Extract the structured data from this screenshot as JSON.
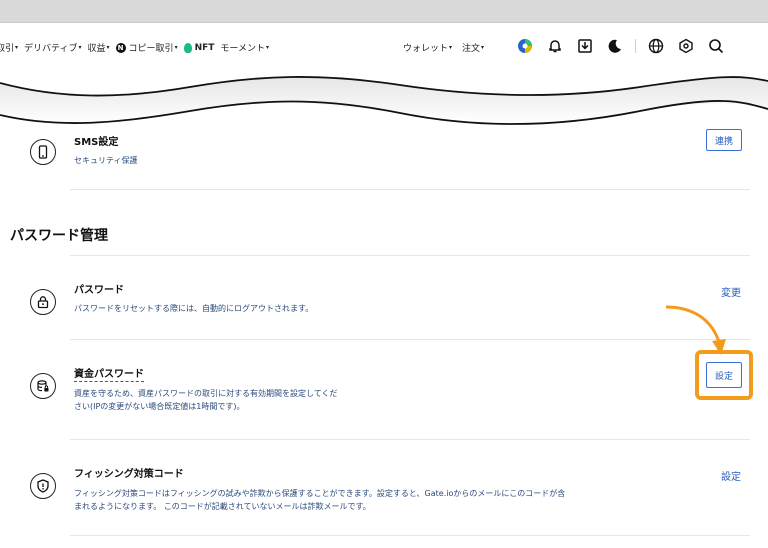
{
  "nav": {
    "items": [
      {
        "label": "取引",
        "caret": "▾"
      },
      {
        "label": "デリバティブ",
        "caret": "▾"
      },
      {
        "label": "収益",
        "caret": "▾"
      },
      {
        "label": "コピー取引",
        "caret": "▾"
      },
      {
        "label": "NFT"
      },
      {
        "label": "モーメント",
        "caret": "▾"
      }
    ],
    "n_logo": "N",
    "wallet": "ウォレット",
    "orders": "注文",
    "caret": "▾"
  },
  "sms": {
    "title": "SMS設定",
    "desc": "セキュリティ保護",
    "button": "連携"
  },
  "password_section": {
    "title": "パスワード管理"
  },
  "password": {
    "title": "パスワード",
    "desc": "パスワードをリセットする際には、自動的にログアウトされます。",
    "button": "変更"
  },
  "fund_password": {
    "title": "資金パスワード",
    "desc_line1": "資産を守るため、資産パスワードの取引に対する有効期間を設定してくだ",
    "desc_line2": "さい(IPの変更がない場合既定値は1時間です)。",
    "button": "設定"
  },
  "anti_phishing": {
    "title": "フィッシング対策コード",
    "desc_line1": "フィッシング対策コードはフィッシングの試みや詐欺から保護することができます。設定すると、Gate.ioからのメールにこのコードが含",
    "desc_line2": "まれるようになります。 このコードが記載されていないメールは詐欺メールです。",
    "button": "設定"
  },
  "colors": {
    "accent": "#2a5ec2",
    "highlight": "#f39b1c"
  }
}
